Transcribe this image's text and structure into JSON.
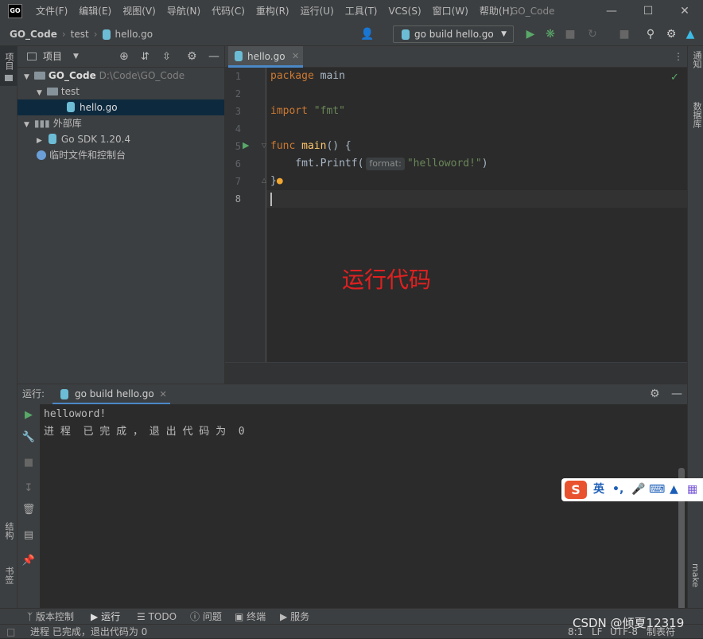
{
  "menu": [
    "文件(F)",
    "编辑(E)",
    "视图(V)",
    "导航(N)",
    "代码(C)",
    "重构(R)",
    "运行(U)",
    "工具(T)",
    "VCS(S)",
    "窗口(W)",
    "帮助(H)"
  ],
  "window_title": "GO_Code",
  "logo_text": "GO",
  "breadcrumb": {
    "project": "GO_Code",
    "folder": "test",
    "file": "hello.go"
  },
  "run_config": "go build hello.go",
  "left_strip": {
    "project": "项目",
    "structure": "结构",
    "bookmarks": "书签"
  },
  "right_strip": {
    "notifications": "通知",
    "database": "数据库",
    "make": "make"
  },
  "project_panel": {
    "title": "项目",
    "tree": [
      {
        "label": "GO_Code",
        "path": "D:\\Code\\GO_Code"
      },
      {
        "label": "test"
      },
      {
        "label": "hello.go"
      },
      {
        "label": "外部库"
      },
      {
        "label": "Go SDK 1.20.4"
      },
      {
        "label": "临时文件和控制台"
      }
    ]
  },
  "editor": {
    "tab": "hello.go",
    "line_numbers": [
      "1",
      "2",
      "3",
      "4",
      "5",
      "6",
      "7",
      "8"
    ],
    "code": {
      "l1_kw": "package",
      "l1_rest": " main",
      "l3_kw": "import",
      "l3_str": " \"fmt\"",
      "l5_kw": "func",
      "l5_fn": " main",
      "l5_rest": "() {",
      "l6_call": "    fmt.Printf(",
      "l6_hint": "format:",
      "l6_str": "\"helloword!\"",
      "l6_end": ")",
      "l7": "}"
    },
    "annotation": "运行代码"
  },
  "run_panel": {
    "label": "运行:",
    "tab": "go build hello.go",
    "output": [
      "helloword!",
      "进 程  已 完 成 ， 退 出 代 码 为  0"
    ]
  },
  "ime": {
    "lang": "英",
    "punct": "•,"
  },
  "bottom_tabs": [
    "版本控制",
    "运行",
    "TODO",
    "问题",
    "终端",
    "服务"
  ],
  "status": {
    "message": "进程 已完成，退出代码为 0",
    "position": "8:1",
    "line_sep": "LF",
    "encoding": "UTF-8",
    "indent": "制表符"
  },
  "watermark": "CSDN @倾夏12319",
  "colors": {
    "accent": "#4a88c7",
    "annotation": "#e02020"
  }
}
